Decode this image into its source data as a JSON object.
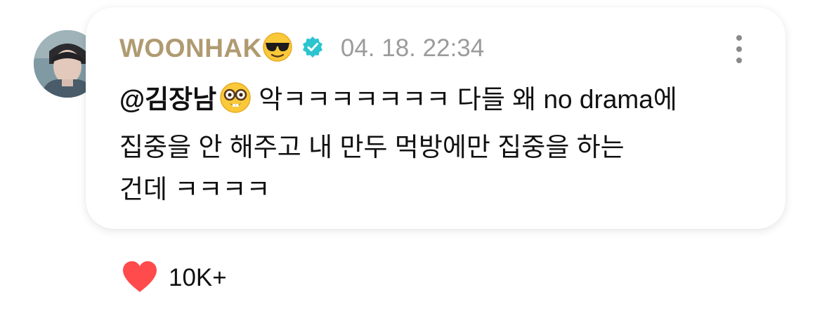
{
  "post": {
    "author": "WOONHAK",
    "author_emoji": "sunglasses-emoji",
    "verified": true,
    "timestamp": "04. 18. 22:34",
    "mention": "@김장남",
    "mention_emoji": "nerd-face-emoji",
    "text_line1": "악ㅋㅋㅋㅋㅋㅋㅋ 다들 왜 no drama에",
    "text_line2": "집중을 안 해주고 내 만두 먹방에만 집중을 하는",
    "text_line3": "건데 ㅋㅋㅋㅋ"
  },
  "reactions": {
    "like_icon": "heart-icon",
    "like_count": "10K+"
  },
  "colors": {
    "author_name": "#b09a71",
    "verified_badge": "#2cc4cf",
    "timestamp": "#9b9b9b",
    "heart": "#ff4b4b"
  }
}
